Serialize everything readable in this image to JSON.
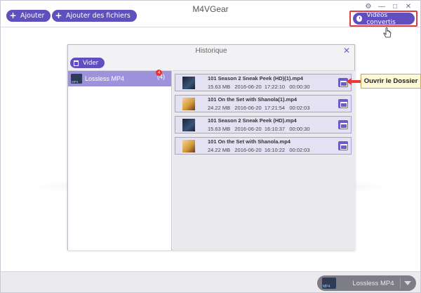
{
  "app": {
    "title": "M4VGear"
  },
  "toolbar": {
    "add_label": "Ajouter",
    "add_files_label": "Ajouter des fichiers",
    "converted_label": "Vidéos convertis"
  },
  "history": {
    "title": "Historique",
    "clear_label": "Vider",
    "close_glyph": "✕",
    "category": {
      "label": "Lossless MP4",
      "count": "(4)",
      "badge": "4"
    },
    "files": [
      {
        "name": "101 Season 2 Sneak Peek (HD)(1).mp4",
        "meta": "15.63 MB   2016-06-20  17:22:10   00:00:30",
        "thumb": "thumb-a"
      },
      {
        "name": "101 On the Set with Shanola(1).mp4",
        "meta": "24.22 MB   2016-06-20  17:21:54   00:02:03",
        "thumb": "thumb-b"
      },
      {
        "name": "101 Season 2 Sneak Peek (HD).mp4",
        "meta": "15.63 MB   2016-06-20  16:10:37   00:00:30",
        "thumb": "thumb-a"
      },
      {
        "name": "101 On the Set with Shanola.mp4",
        "meta": "24.22 MB   2016-06-20  16:10:22   00:02:03",
        "thumb": "thumb-b"
      }
    ]
  },
  "callout": {
    "label": "Ouvrir le Dossier"
  },
  "bottom": {
    "format_label": "Lossless MP4"
  },
  "icons": {
    "settings": "gear-icon",
    "minimize": "minimize-icon",
    "maximize": "maximize-icon",
    "close": "close-icon"
  },
  "colors": {
    "accent": "#5f4fbf",
    "highlight": "#e43b3b",
    "selected": "#9f92dd"
  }
}
